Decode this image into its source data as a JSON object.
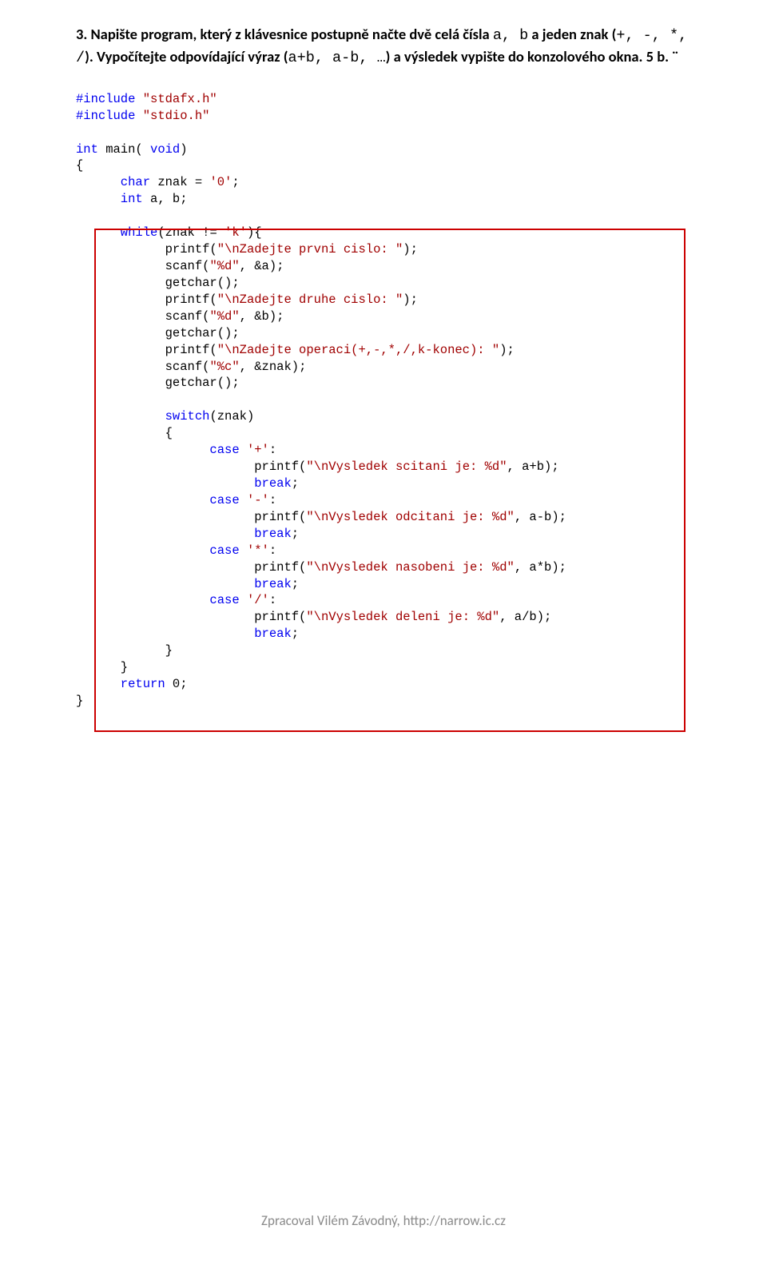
{
  "task": {
    "prefix": "3. Napište program, který z klávesnice postupně načte dvě celá čísla ",
    "ab": "a, b",
    "mid1": "  a jeden znak (",
    "ops": "+, -, *, /",
    "mid2": "). Vypočítejte odpovídající výraz (",
    "exprs": "a+b, a-b, …",
    "mid3": ") a výsledek vypište do konzolového okna.",
    "points": " 5 b."
  },
  "code": {
    "l01a": "#include",
    "l01b": " \"stdafx.h\"",
    "l02a": "#include",
    "l02b": " \"stdio.h\"",
    "l03": "",
    "l04a": "int",
    "l04b": " main( ",
    "l04c": "void",
    "l04d": ")",
    "l05": "{",
    "l06a": "      char",
    "l06b": " znak = ",
    "l06c": "'0'",
    "l06d": ";",
    "l07a": "      int",
    "l07b": " a, b;",
    "l08": "",
    "l09a": "      while",
    "l09b": "(znak != ",
    "l09c": "'k'",
    "l09d": "){",
    "l10a": "            printf(",
    "l10b": "\"\\nZadejte prvni cislo: \"",
    "l10c": ");",
    "l11a": "            scanf(",
    "l11b": "\"%d\"",
    "l11c": ", &a);",
    "l12": "            getchar();",
    "l13a": "            printf(",
    "l13b": "\"\\nZadejte druhe cislo: \"",
    "l13c": ");",
    "l14a": "            scanf(",
    "l14b": "\"%d\"",
    "l14c": ", &b);",
    "l15": "            getchar();",
    "l16a": "            printf(",
    "l16b": "\"\\nZadejte operaci(+,-,*,/,k-konec): \"",
    "l16c": ");",
    "l17a": "            scanf(",
    "l17b": "\"%c\"",
    "l17c": ", &znak);",
    "l18": "            getchar();",
    "l19": "",
    "l20a": "            switch",
    "l20b": "(znak)",
    "l21": "            {",
    "l22a": "                  case",
    "l22b": " '+'",
    "l22c": ":",
    "l23a": "                        printf(",
    "l23b": "\"\\nVysledek scitani je: %d\"",
    "l23c": ", a+b);",
    "l24a": "                        break",
    "l24b": ";",
    "l25a": "                  case",
    "l25b": " '-'",
    "l25c": ":",
    "l26a": "                        printf(",
    "l26b": "\"\\nVysledek odcitani je: %d\"",
    "l26c": ", a-b);",
    "l27a": "                        break",
    "l27b": ";",
    "l28a": "                  case",
    "l28b": " '*'",
    "l28c": ":",
    "l29a": "                        printf(",
    "l29b": "\"\\nVysledek nasobeni je: %d\"",
    "l29c": ", a*b);",
    "l30a": "                        break",
    "l30b": ";",
    "l31a": "                  case",
    "l31b": " '/'",
    "l31c": ":",
    "l32a": "                        printf(",
    "l32b": "\"\\nVysledek deleni je: %d\"",
    "l32c": ", a/b);",
    "l33a": "                        break",
    "l33b": ";",
    "l34": "            }",
    "l35": "      }",
    "l36a": "      return",
    "l36b": " 0;",
    "l37": "}"
  },
  "footer": "Zpracoval Vilém Závodný, http://narrow.ic.cz"
}
